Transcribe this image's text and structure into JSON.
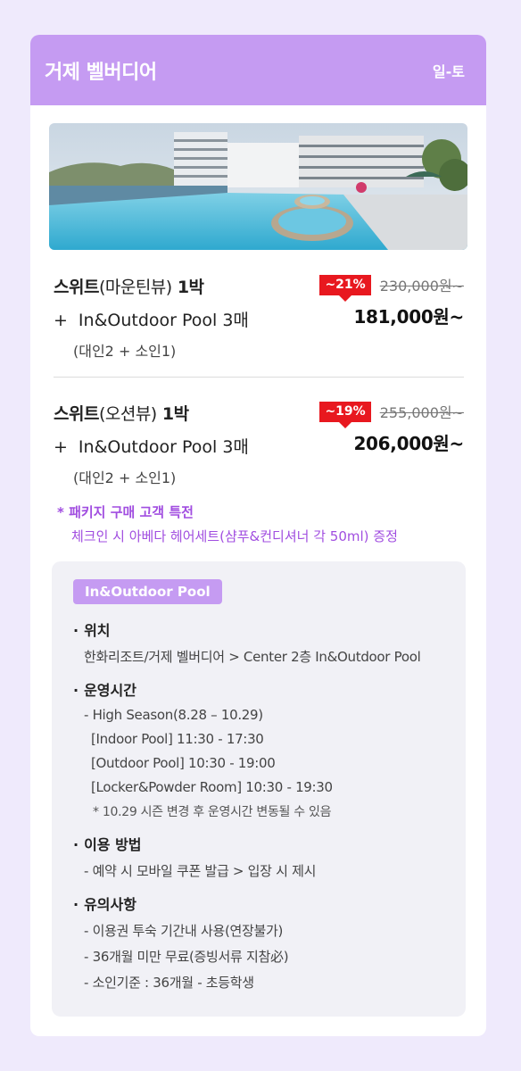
{
  "header": {
    "title": "거제 벨버디어",
    "days": "일-토"
  },
  "offers": [
    {
      "room": "스위트",
      "view": "(마운틴뷰)",
      "nights": "1박",
      "pool_plus": "+",
      "pool": "In&Outdoor Pool 3매",
      "people": "(대인2 + 소인1)",
      "discount": "~21%",
      "old_price": "230,000원~",
      "new_price": "181,000원~"
    },
    {
      "room": "스위트",
      "view": "(오션뷰)",
      "nights": "1박",
      "pool_plus": "+",
      "pool": "In&Outdoor Pool 3매",
      "people": "(대인2 + 소인1)",
      "discount": "~19%",
      "old_price": "255,000원~",
      "new_price": "206,000원~"
    }
  ],
  "benefit": {
    "title": "* 패키지 구매 고객 특전",
    "desc": "체크인 시 아베다 헤어세트(샴푸&컨디셔너 각 50ml) 증정"
  },
  "info": {
    "tag": "In&Outdoor Pool",
    "location": {
      "title": "위치",
      "text": "한화리조트/거제 벨버디어 > Center 2층  In&Outdoor Pool"
    },
    "hours": {
      "title": "운영시간",
      "season": "- High Season(8.28 – 10.29)",
      "indoor": "[Indoor Pool] 11:30 - 17:30",
      "outdoor": "[Outdoor Pool] 10:30 - 19:00",
      "locker": "[Locker&Powder Room] 10:30 - 19:30",
      "note": "* 10.29 시즌 변경 후 운영시간 변동될 수 있음"
    },
    "usage": {
      "title": "이용 방법",
      "text": "-  예약 시 모바일 쿠폰 발급 > 입장 시 제시"
    },
    "caution": {
      "title": "유의사항",
      "items": [
        "- 이용권 투숙 기간내 사용(연장불가)",
        "- 36개월 미만 무료(증빙서류 지참必)",
        "- 소인기준 : 36개월 - 초등학생"
      ]
    },
    "bullet": "·"
  },
  "colors": {
    "accent": "#c59bf2",
    "discount": "#e8181f",
    "benefit": "#a14ee0",
    "background": "#efeafc"
  }
}
